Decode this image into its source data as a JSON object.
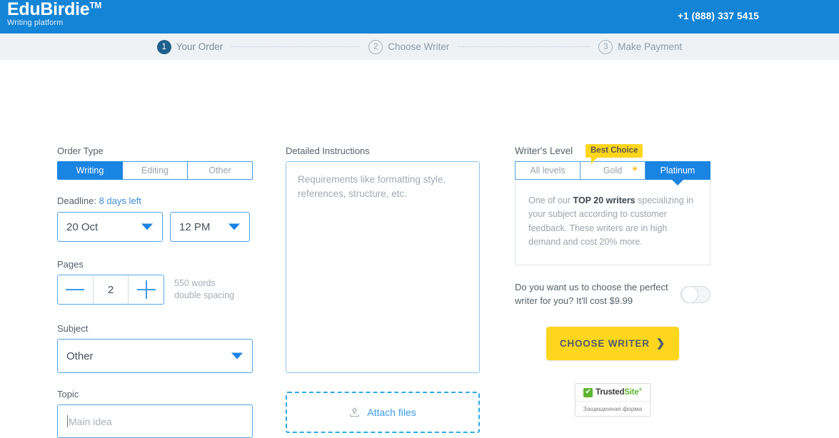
{
  "header": {
    "brand_name": "EduBirdie",
    "brand_tm": "TM",
    "brand_sub": "Writing platform",
    "phone": "+1 (888) 337 5415",
    "brand_bg": "#1484d6"
  },
  "steps": [
    {
      "num": "1",
      "label": "Your Order",
      "state": "active"
    },
    {
      "num": "2",
      "label": "Choose Writer",
      "state": "idle"
    },
    {
      "num": "3",
      "label": "Make Payment",
      "state": "idle"
    }
  ],
  "order_type": {
    "label": "Order Type",
    "options": [
      "Writing",
      "Editing",
      "Other"
    ],
    "selected": "Writing"
  },
  "deadline": {
    "label": "Deadline:",
    "days_left": "8 days left",
    "date_value": "20 Oct",
    "time_value": "12 PM"
  },
  "pages": {
    "label": "Pages",
    "minus": "−",
    "value": "2",
    "plus": "+",
    "words_line1": "550 words",
    "words_line2": "double spacing"
  },
  "subject": {
    "label": "Subject",
    "value": "Other"
  },
  "topic": {
    "label": "Topic",
    "placeholder": "Main idea",
    "value": ""
  },
  "instructions": {
    "label": "Detailed Instructions",
    "placeholder": "Requirements like formatting style, references, structure, etc.",
    "value": ""
  },
  "attach": {
    "label": "Attach files"
  },
  "writer_level": {
    "label": "Writer's Level",
    "badge": "Best Choice",
    "options": [
      "All levels",
      "Gold",
      "Platinum"
    ],
    "selected": "Platinum",
    "gold_star": "★",
    "description_pre": "One of our ",
    "description_bold": "TOP 20 writers",
    "description_post": " specializing in your subject according to customer feedback. These writers are in high demand and cost 20% more."
  },
  "perfect_writer": {
    "text": "Do you want us to choose the perfect writer for you? It'll cost $9.99",
    "toggle_state": "off"
  },
  "cta": {
    "label": "CHOOSE WRITER",
    "chevron": "❯",
    "color": "#ffd61e"
  },
  "trusted": {
    "check": "✔",
    "name_dark": "Trusted",
    "name_green": "Site",
    "registered": "®",
    "subtitle": "Защищенная форма"
  }
}
